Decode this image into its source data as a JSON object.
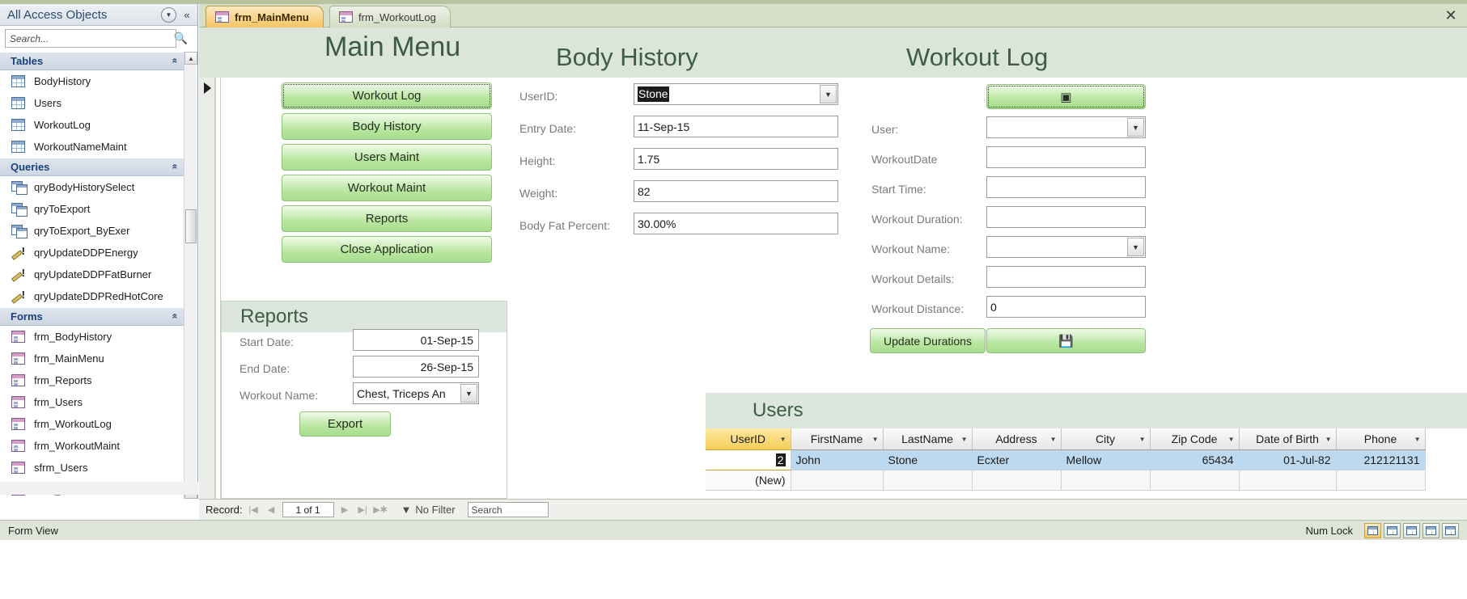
{
  "navpane": {
    "title": "All Access Objects",
    "search_placeholder": "Search...",
    "groups": [
      {
        "label": "Tables",
        "items": [
          {
            "label": "BodyHistory",
            "icon": "table-icon"
          },
          {
            "label": "Users",
            "icon": "table-icon"
          },
          {
            "label": "WorkoutLog",
            "icon": "table-icon"
          },
          {
            "label": "WorkoutNameMaint",
            "icon": "table-icon"
          }
        ]
      },
      {
        "label": "Queries",
        "items": [
          {
            "label": "qryBodyHistorySelect",
            "icon": "select-query-icon"
          },
          {
            "label": "qryToExport",
            "icon": "select-query-icon"
          },
          {
            "label": "qryToExport_ByExer",
            "icon": "select-query-icon"
          },
          {
            "label": "qryUpdateDDPEnergy",
            "icon": "update-query-icon"
          },
          {
            "label": "qryUpdateDDPFatBurner",
            "icon": "update-query-icon"
          },
          {
            "label": "qryUpdateDDPRedHotCore",
            "icon": "update-query-icon"
          }
        ]
      },
      {
        "label": "Forms",
        "items": [
          {
            "label": "frm_BodyHistory",
            "icon": "form-icon"
          },
          {
            "label": "frm_MainMenu",
            "icon": "form-icon"
          },
          {
            "label": "frm_Reports",
            "icon": "form-icon"
          },
          {
            "label": "frm_Users",
            "icon": "form-icon"
          },
          {
            "label": "frm_WorkoutLog",
            "icon": "form-icon"
          },
          {
            "label": "frm_WorkoutMaint",
            "icon": "form-icon"
          },
          {
            "label": "sfrm_Users",
            "icon": "form-icon"
          },
          {
            "label": "sfrm_WorkoutNameMaint",
            "icon": "form-icon"
          }
        ]
      }
    ]
  },
  "tabs": [
    {
      "label": "frm_MainMenu",
      "active": true
    },
    {
      "label": "frm_WorkoutLog",
      "active": false
    }
  ],
  "headers": {
    "main_menu": "Main Menu",
    "body_history": "Body History",
    "workout_log": "Workout Log"
  },
  "menu_buttons": [
    {
      "label": "Workout Log",
      "focused": true
    },
    {
      "label": "Body History",
      "focused": false
    },
    {
      "label": "Users Maint",
      "focused": false
    },
    {
      "label": "Workout Maint",
      "focused": false
    },
    {
      "label": "Reports",
      "focused": false
    },
    {
      "label": "Close Application",
      "focused": false
    }
  ],
  "body_history_form": {
    "fields": [
      {
        "label": "UserID:",
        "value": "Stone",
        "type": "combo",
        "selected": true
      },
      {
        "label": "Entry Date:",
        "value": "11-Sep-15",
        "type": "text"
      },
      {
        "label": "Height:",
        "value": "1.75",
        "type": "text"
      },
      {
        "label": "Weight:",
        "value": "82",
        "type": "text"
      },
      {
        "label": "Body Fat Percent:",
        "value": "30.00%",
        "type": "text"
      }
    ]
  },
  "workout_log_form": {
    "fields": [
      {
        "label": "User:",
        "value": "",
        "type": "combo"
      },
      {
        "label": "WorkoutDate",
        "value": "",
        "type": "text"
      },
      {
        "label": "Start Time:",
        "value": "",
        "type": "text"
      },
      {
        "label": "Workout Duration:",
        "value": "",
        "type": "text"
      },
      {
        "label": "Workout Name:",
        "value": "",
        "type": "combo"
      },
      {
        "label": "Workout Details:",
        "value": "",
        "type": "text"
      },
      {
        "label": "Workout Distance:",
        "value": "0",
        "type": "text"
      }
    ],
    "update_durations_label": "Update Durations",
    "new_record_icon": "new-record-icon",
    "save_icon": "save-icon"
  },
  "reports_subform": {
    "title": "Reports",
    "fields": [
      {
        "label": "Start Date:",
        "value": "01-Sep-15"
      },
      {
        "label": "End Date:",
        "value": "26-Sep-15"
      },
      {
        "label": "Workout Name:",
        "value": "Chest, Triceps An"
      }
    ],
    "export_label": "Export"
  },
  "users_datasheet": {
    "title": "Users",
    "columns": [
      "UserID",
      "FirstName",
      "LastName",
      "Address",
      "City",
      "Zip Code",
      "Date of Birth",
      "Phone"
    ],
    "active_column": "UserID",
    "rows": [
      {
        "selected": true,
        "cells": [
          "2",
          "John",
          "Stone",
          "Ecxter",
          "Mellow",
          "65434",
          "01-Jul-82",
          "212121131"
        ]
      },
      {
        "new": true,
        "cells": [
          "(New)",
          "",
          "",
          "",
          "",
          "",
          "",
          ""
        ]
      }
    ]
  },
  "record_nav": {
    "label": "Record:",
    "position": "1 of 1",
    "filter_label": "No Filter",
    "search_placeholder": "Search"
  },
  "statusbar": {
    "view": "Form View",
    "numlock": "Num Lock"
  },
  "colors": {
    "accent_green": "#a8dd8d",
    "header_green": "#3f5c46",
    "band_green": "#dce5da",
    "tab_active": "#f6c462",
    "row_selected": "#bcd9f0",
    "active_column": "#f5cf5a"
  }
}
